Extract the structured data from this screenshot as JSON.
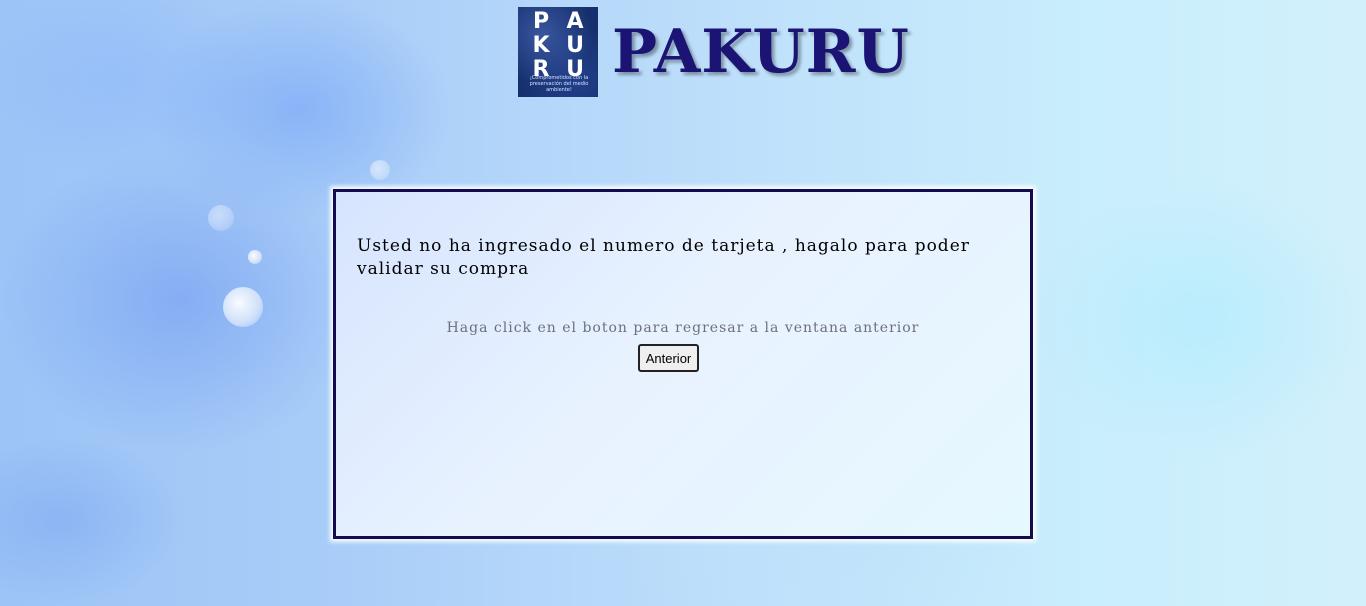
{
  "header": {
    "logo_letters": [
      "P",
      "A",
      "K",
      "U",
      "R",
      "U"
    ],
    "logo_tagline": "¡Comprometidos con la preservación del medio ambiente!",
    "title": "PAKURU"
  },
  "main": {
    "message": "Usted no ha ingresado el numero de tarjeta , hagalo para poder validar su compra",
    "instruction": "Haga click en el boton para regresar a la ventana anterior",
    "back_button_label": "Anterior"
  },
  "colors": {
    "brand_title": "#1b1474",
    "panel_border": "#140a50",
    "logo_background": "#16306e"
  }
}
